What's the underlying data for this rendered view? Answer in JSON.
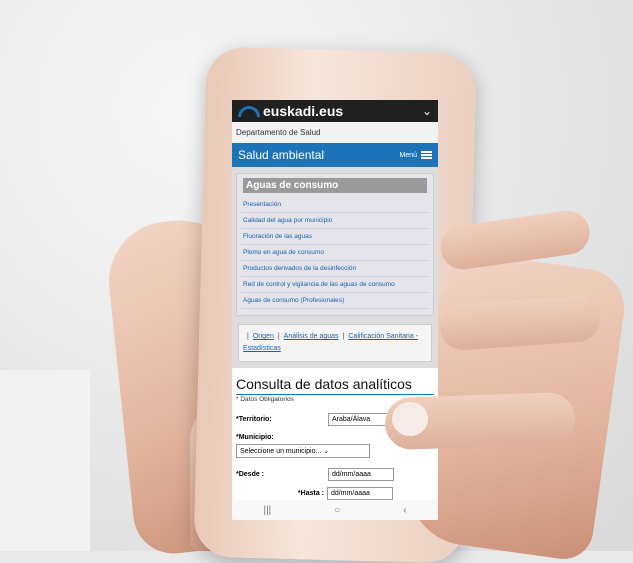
{
  "header": {
    "logo_text": "euskadi.eus",
    "chevron": "chevron-down-icon"
  },
  "department": "Departamento de Salud",
  "section_bar": {
    "title": "Salud ambiental",
    "menu_label": "Menú",
    "menu_icon": "hamburger-icon"
  },
  "aguas": {
    "title": "Aguas de consumo",
    "links": [
      "Presentación",
      "Calidad del agua por municipio",
      "Fluoración de las aguas",
      "Plomo en agua de consumo",
      "Productos derivados de la desinfección",
      "Red de control y vigilancia de las aguas de consumo",
      "Aguas de consumo (Profesionales)"
    ]
  },
  "tabs": {
    "origen": "Origen",
    "analisis": "Análisis de aguas",
    "calificacion": "Calificación Sanitaria - Estadísticas"
  },
  "consulta": {
    "title": "Consulta de datos analíticos",
    "obligatorios": "* Datos Obligatorios",
    "territorio_label": "*Territorio:",
    "territorio_value": "Araba/Álava",
    "municipio_label": "*Municipio:",
    "municipio_value": "Seleccione un municipio...",
    "desde_label": "*Desde :",
    "desde_placeholder": "dd/mm/aaaa",
    "hasta_label": "*Hasta :",
    "hasta_placeholder": "dd/mm/aaaa"
  },
  "colors": {
    "brand_blue": "#1d73b8",
    "topbar": "#202020"
  }
}
